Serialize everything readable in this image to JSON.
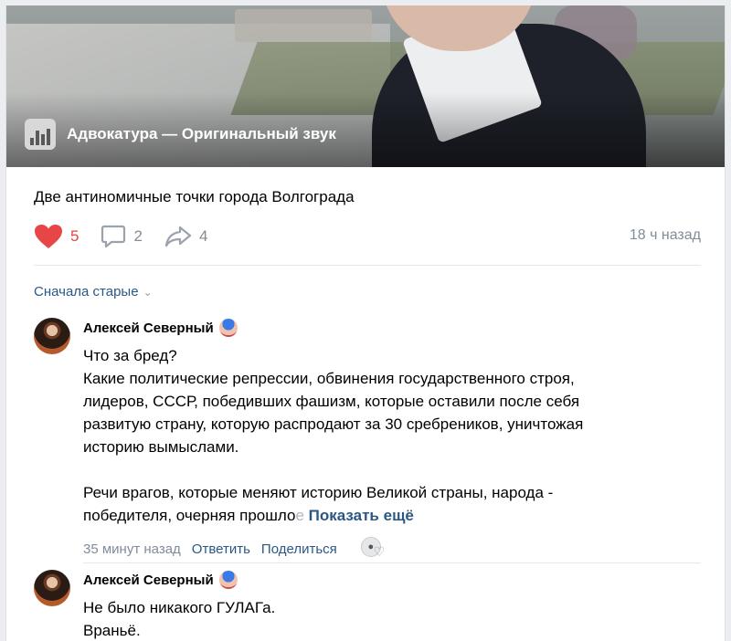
{
  "video": {
    "audio_label": "Адвокатура — Оригинальный звук"
  },
  "post": {
    "text": "Две антиномичные точки города Волгограда",
    "likes": "5",
    "comments": "2",
    "shares": "4",
    "time": "18 ч назад"
  },
  "sort_label": "Сначала старые",
  "comments": [
    {
      "author": "Алексей Северный",
      "lines": [
        "Что за бред?",
        "Какие политические репрессии, обвинения государственного строя,",
        "лидеров, СССР, победивших фашизм, которые оставили после себя",
        "развитую страну, которую распродают за 30 сребреников, уничтожая",
        "историю вымыслами.",
        "",
        "Речи врагов, которые меняют историю Великой страны, народа -"
      ],
      "last_line_start": "победителя, очерняя прошло",
      "last_line_fade": "е",
      "show_more": "Показать ещё",
      "time": "35 минут назад",
      "reply": "Ответить",
      "share": "Поделиться"
    },
    {
      "author": "Алексей Северный",
      "lines": [
        "Не было никакого ГУЛАГа.",
        "Враньё."
      ]
    }
  ],
  "colors": {
    "link": "#2a5885",
    "muted": "#818c99",
    "like": "#e64646"
  }
}
